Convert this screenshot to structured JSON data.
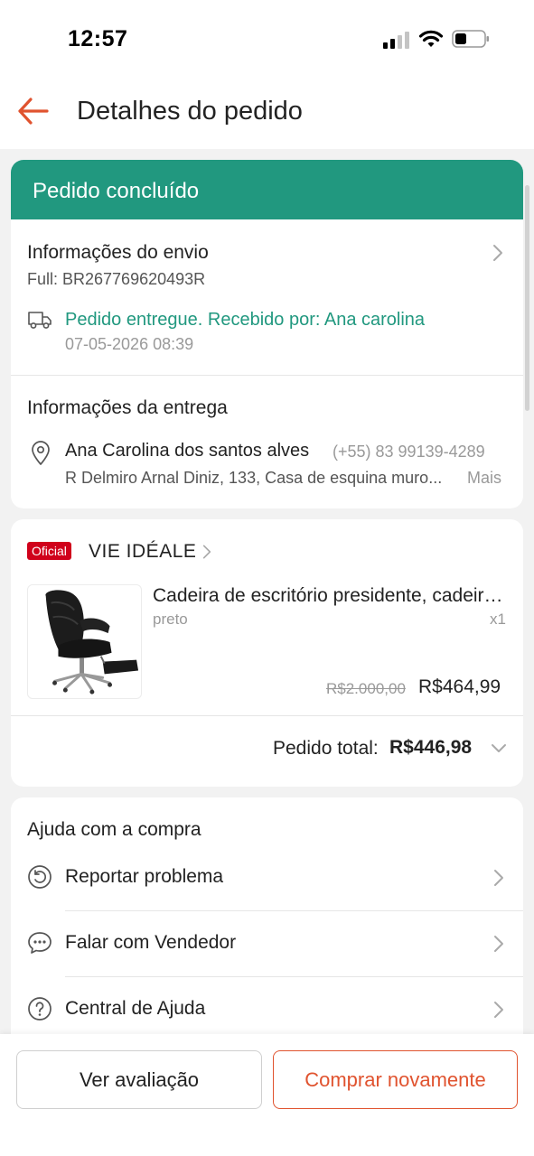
{
  "status_bar": {
    "time": "12:57"
  },
  "header": {
    "title": "Detalhes do pedido"
  },
  "order": {
    "status": "Pedido concluído",
    "shipping": {
      "title": "Informações do envio",
      "tracking": "Full: BR267769620493R",
      "delivered_text": "Pedido entregue. Recebido por: Ana carolina",
      "delivered_at": "07-05-2026 08:39"
    },
    "delivery": {
      "title": "Informações da entrega",
      "name": "Ana Carolina dos santos alves",
      "phone": "(+55) 83 99139-4289",
      "address": "R Delmiro Arnal Diniz, 133, Casa de esquina muro...",
      "more": "Mais"
    }
  },
  "store": {
    "badge": "Oficial",
    "name": "VIE IDÉALE",
    "product": {
      "name": "Cadeira de escritório presidente, cadeira gamer",
      "variant": "preto",
      "quantity": "x1",
      "old_price": "R$2.000,00",
      "price": "R$464,99"
    },
    "total_label": "Pedido total:",
    "total_value": "R$446,98"
  },
  "help": {
    "title": "Ajuda com a compra",
    "items": [
      {
        "label": "Reportar problema",
        "icon": "report-problem-icon"
      },
      {
        "label": "Falar com Vendedor",
        "icon": "chat-icon"
      },
      {
        "label": "Central de Ajuda",
        "icon": "help-icon"
      }
    ]
  },
  "actions": {
    "review": "Ver avaliação",
    "buy_again": "Comprar novamente"
  },
  "colors": {
    "accent": "#21987f",
    "brand": "#e0532f",
    "official_badge": "#d0011b"
  }
}
